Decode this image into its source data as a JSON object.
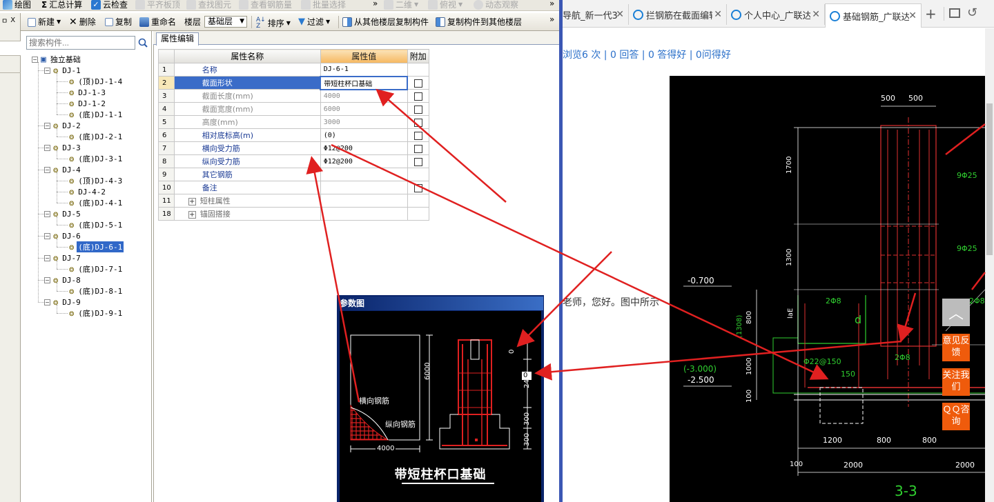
{
  "toolbar_top": {
    "items": [
      "绘图",
      "汇总计算",
      "云检查",
      "平齐板顶",
      "查找图元",
      "查看钢筋量",
      "批量选择",
      "二维",
      "俯视",
      "动态观察"
    ],
    "more": "»"
  },
  "toolbar_main": {
    "new": "新建",
    "delete": "删除",
    "copy": "复制",
    "rename": "重命名",
    "floor_label": "楼层",
    "floor_value": "基础层",
    "sort": "排序",
    "filter": "过滤",
    "copy_from_floor": "从其他楼层复制构件",
    "copy_to_floor": "复制构件到其他楼层",
    "more": "»"
  },
  "left_strip": {
    "pin": "ㅁ",
    "close": "X"
  },
  "tree": {
    "search_placeholder": "搜索构件...",
    "root": "独立基础",
    "nodes": [
      {
        "label": "DJ-1",
        "children": [
          "(顶)DJ-1-4",
          "DJ-1-3",
          "DJ-1-2",
          "(底)DJ-1-1"
        ]
      },
      {
        "label": "DJ-2",
        "children": [
          "(底)DJ-2-1"
        ]
      },
      {
        "label": "DJ-3",
        "children": [
          "(底)DJ-3-1"
        ]
      },
      {
        "label": "DJ-4",
        "children": [
          "(顶)DJ-4-3",
          "DJ-4-2",
          "(底)DJ-4-1"
        ]
      },
      {
        "label": "DJ-5",
        "children": [
          "(底)DJ-5-1"
        ]
      },
      {
        "label": "DJ-6",
        "children": [
          "(底)DJ-6-1"
        ]
      },
      {
        "label": "DJ-7",
        "children": [
          "(底)DJ-7-1"
        ]
      },
      {
        "label": "DJ-8",
        "children": [
          "(底)DJ-8-1"
        ]
      },
      {
        "label": "DJ-9",
        "children": [
          "(底)DJ-9-1"
        ]
      }
    ],
    "selected": "(底)DJ-6-1"
  },
  "property_editor": {
    "tab": "属性编辑",
    "columns": [
      "属性名称",
      "属性值",
      "附加"
    ],
    "rows": [
      {
        "no": "1",
        "name": "名称",
        "value": "DJ-6-1",
        "check": false,
        "style": "normal"
      },
      {
        "no": "2",
        "name": "截面形状",
        "value": "带短柱杯口基础",
        "check": true,
        "style": "selected"
      },
      {
        "no": "3",
        "name": "截面长度(mm)",
        "value": "4000",
        "check": true,
        "style": "gray"
      },
      {
        "no": "4",
        "name": "截面宽度(mm)",
        "value": "6000",
        "check": true,
        "style": "gray"
      },
      {
        "no": "5",
        "name": "高度(mm)",
        "value": "3000",
        "check": true,
        "style": "gray"
      },
      {
        "no": "6",
        "name": "相对底标高(m)",
        "value": "(0)",
        "check": true,
        "style": "normal"
      },
      {
        "no": "7",
        "name": "横向受力筋",
        "value": "Φ12@200",
        "check": true,
        "style": "normal"
      },
      {
        "no": "8",
        "name": "纵向受力筋",
        "value": "Φ12@200",
        "check": true,
        "style": "normal"
      },
      {
        "no": "9",
        "name": "其它钢筋",
        "value": "",
        "check": false,
        "style": "normal"
      },
      {
        "no": "10",
        "name": "备注",
        "value": "",
        "check": true,
        "style": "normal"
      },
      {
        "no": "11",
        "name": "短柱属性",
        "value": "",
        "check": false,
        "style": "group"
      },
      {
        "no": "18",
        "name": "锚固搭接",
        "value": "",
        "check": false,
        "style": "group"
      }
    ]
  },
  "param_dialog": {
    "title": "参数图",
    "label_transverse": "横向钢筋",
    "label_longitudinal": "纵向钢筋",
    "dim_width": "4000",
    "dim_height": "6000",
    "dim_top": "0",
    "dim_box": "0",
    "dim_24": "24",
    "dim_300a": "300",
    "dim_300b": "300",
    "caption": "带短柱杯口基础"
  },
  "browser": {
    "tabs": [
      {
        "title": "导航_新一代3",
        "icon": false,
        "active": false
      },
      {
        "title": "拦钢筋在截面编辑",
        "icon": true,
        "active": false
      },
      {
        "title": "个人中心_广联达",
        "icon": true,
        "active": false
      },
      {
        "title": "基础钢筋_广联达",
        "icon": true,
        "active": true
      }
    ],
    "new_tab": "+",
    "stats": "浏览6 次 | 0 回答 | 0 答得好 | 0问得好",
    "question": "老师，您好。图中所示",
    "side_buttons": {
      "top": "︿",
      "feedback": "意见反馈",
      "follow": "关注我们",
      "qq": "ＱＱ咨询"
    },
    "cad": {
      "d500a": "500",
      "d500b": "500",
      "d1700": "1700",
      "d1300": "1300",
      "d9a": "9Φ25",
      "d9b": "9Φ25",
      "lev1": "-0.700",
      "lev2": "(-3.000)",
      "lev3": "-2.500",
      "d2a": "2Φ8",
      "d2b": "2Φ8",
      "d2c": "2Φ8",
      "d": "d",
      "laE": "laE",
      "d1308": "(1308)",
      "d800": "800",
      "d1000": "1000",
      "d100": "100",
      "d150": "150",
      "d22": "Φ22@150",
      "b1200": "1200",
      "b800a": "800",
      "b800b": "800",
      "b100": "100",
      "b2000a": "2000",
      "b2000b": "2000",
      "sec": "3-3"
    }
  }
}
